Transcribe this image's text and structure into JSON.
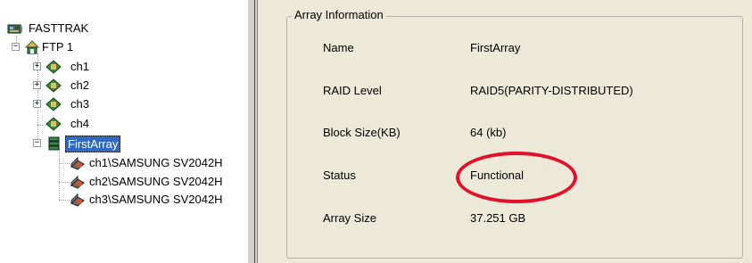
{
  "tree": {
    "root": {
      "label": "FASTTRAK",
      "icon": "controller-board-icon"
    },
    "controller": {
      "label": "FTP 1",
      "icon": "controller-home-icon",
      "expander": "−"
    },
    "channels": [
      {
        "label": "ch1",
        "icon": "channel-icon",
        "expander": "+"
      },
      {
        "label": "ch2",
        "icon": "channel-icon",
        "expander": "+"
      },
      {
        "label": "ch3",
        "icon": "channel-icon",
        "expander": "+"
      },
      {
        "label": "ch4",
        "icon": "channel-icon",
        "expander": ""
      }
    ],
    "array": {
      "label": "FirstArray",
      "icon": "array-stack-icon",
      "expander": "−",
      "selected": true
    },
    "disks": [
      {
        "label": "ch1\\SAMSUNG SV2042H",
        "icon": "hard-disk-icon"
      },
      {
        "label": "ch2\\SAMSUNG SV2042H",
        "icon": "hard-disk-icon"
      },
      {
        "label": "ch3\\SAMSUNG SV2042H",
        "icon": "hard-disk-icon"
      }
    ]
  },
  "info": {
    "title": "Array Information",
    "rows": [
      {
        "label": "Name",
        "value": "FirstArray"
      },
      {
        "label": "RAID Level",
        "value": "RAID5(PARITY-DISTRIBUTED)"
      },
      {
        "label": "Block Size(KB)",
        "value": "64 (kb)"
      },
      {
        "label": "Status",
        "value": "Functional"
      },
      {
        "label": "Array Size",
        "value": "37.251 GB"
      }
    ],
    "highlight_color": "#e2102a"
  },
  "colors": {
    "selection": "#316ac5",
    "panel_bg": "#ece9d8"
  }
}
